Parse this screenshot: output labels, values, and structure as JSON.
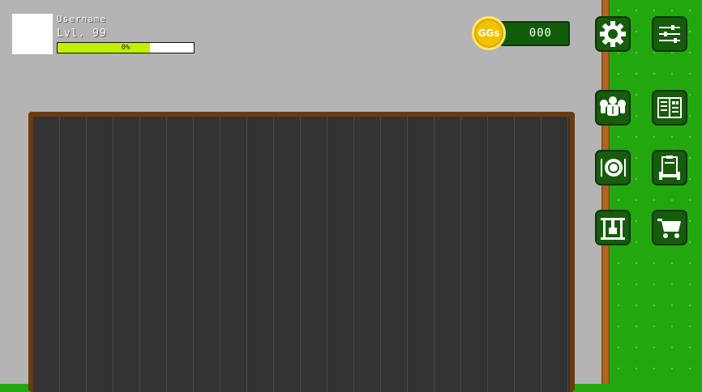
{
  "player": {
    "username": "Username",
    "level": "Lvl. 99",
    "xp_percent": 0.68,
    "xp_label": "0%"
  },
  "currency": {
    "coin_label": "GGs",
    "amount": "000",
    "coin_color": "#f2c200"
  },
  "menu": [
    {
      "icon": "gear-icon"
    },
    {
      "icon": "sliders-icon"
    },
    {
      "icon": "muscle-icon"
    },
    {
      "icon": "stats-book-icon"
    },
    {
      "icon": "meal-plate-icon"
    },
    {
      "icon": "workout-plan-icon"
    },
    {
      "icon": "gym-rack-icon"
    },
    {
      "icon": "shopping-cart-icon"
    }
  ],
  "colors": {
    "grass": "#22a80e",
    "button": "#175c0c",
    "board": "#333333",
    "frame": "#6b3a10"
  }
}
